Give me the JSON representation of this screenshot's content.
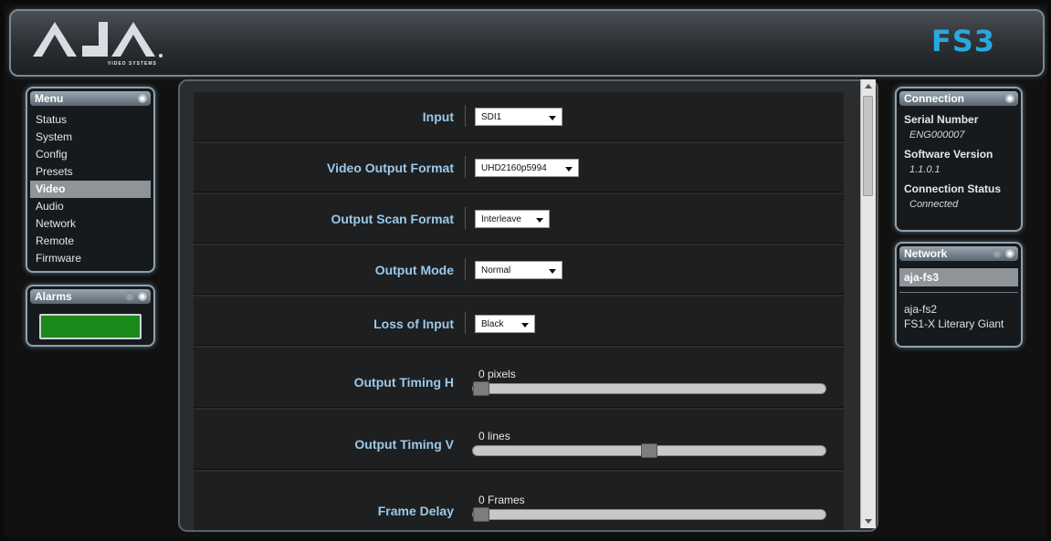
{
  "header": {
    "logo_text": "AJA",
    "logo_subtext": "VIDEO SYSTEMS",
    "model": "FS3",
    "brand_color": "#29a8e0"
  },
  "menu": {
    "title": "Menu",
    "items": [
      {
        "label": "Status"
      },
      {
        "label": "System"
      },
      {
        "label": "Config"
      },
      {
        "label": "Presets"
      },
      {
        "label": "Video",
        "active": true
      },
      {
        "label": "Audio"
      },
      {
        "label": "Network"
      },
      {
        "label": "Remote"
      },
      {
        "label": "Firmware"
      }
    ]
  },
  "alarms": {
    "title": "Alarms",
    "status_color": "#1b8a1b"
  },
  "connection": {
    "title": "Connection",
    "serial_label": "Serial Number",
    "serial_value": "ENG000007",
    "software_label": "Software Version",
    "software_value": "1.1.0.1",
    "status_label": "Connection Status",
    "status_value": "Connected"
  },
  "network": {
    "title": "Network",
    "selected": "aja-fs3",
    "devices": [
      "aja-fs2",
      "FS1-X Literary Giant"
    ]
  },
  "video": {
    "input": {
      "label": "Input",
      "value": "SDI1"
    },
    "video_output_format": {
      "label": "Video Output Format",
      "value": "UHD2160p5994"
    },
    "output_scan_format": {
      "label": "Output Scan Format",
      "value": "Interleave"
    },
    "output_mode": {
      "label": "Output Mode",
      "value": "Normal"
    },
    "loss_of_input": {
      "label": "Loss of Input",
      "value": "Black"
    },
    "output_timing_h": {
      "label": "Output Timing H",
      "value_text": "0 pixels",
      "position": 0.0
    },
    "output_timing_v": {
      "label": "Output Timing V",
      "value_text": "0 lines",
      "position": 0.5
    },
    "frame_delay": {
      "label": "Frame Delay",
      "value_text": "0 Frames",
      "position": 0.0
    }
  }
}
